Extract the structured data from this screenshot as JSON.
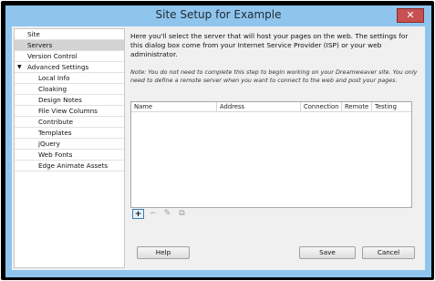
{
  "window": {
    "title": "Site Setup for Example",
    "close_glyph": "✕"
  },
  "sidebar": {
    "items": [
      {
        "label": "Site"
      },
      {
        "label": "Servers"
      },
      {
        "label": "Version Control"
      },
      {
        "label": "Advanced Settings",
        "expanded": true
      },
      {
        "label": "Local Info"
      },
      {
        "label": "Cloaking"
      },
      {
        "label": "Design Notes"
      },
      {
        "label": "File View Columns"
      },
      {
        "label": "Contribute"
      },
      {
        "label": "Templates"
      },
      {
        "label": "jQuery"
      },
      {
        "label": "Web Fonts"
      },
      {
        "label": "Edge Animate Assets"
      }
    ],
    "selected": "Servers"
  },
  "main": {
    "intro": "Here you'll select the server that will host your pages on the web. The settings for this dialog box come from your Internet Service Provider (ISP) or your web administrator.",
    "note": "Note: You do not need to complete this step to begin working on your Dreamweaver site. You only need to define a remote server when you want to connect to the web and post your pages."
  },
  "table": {
    "columns": [
      "Name",
      "Address",
      "Connection",
      "Remote",
      "Testing"
    ],
    "rows": []
  },
  "toolbar": {
    "add_glyph": "+",
    "remove_glyph": "−",
    "edit_glyph": "✎",
    "duplicate_glyph": "⧉"
  },
  "buttons": {
    "help": "Help",
    "save": "Save",
    "cancel": "Cancel"
  }
}
